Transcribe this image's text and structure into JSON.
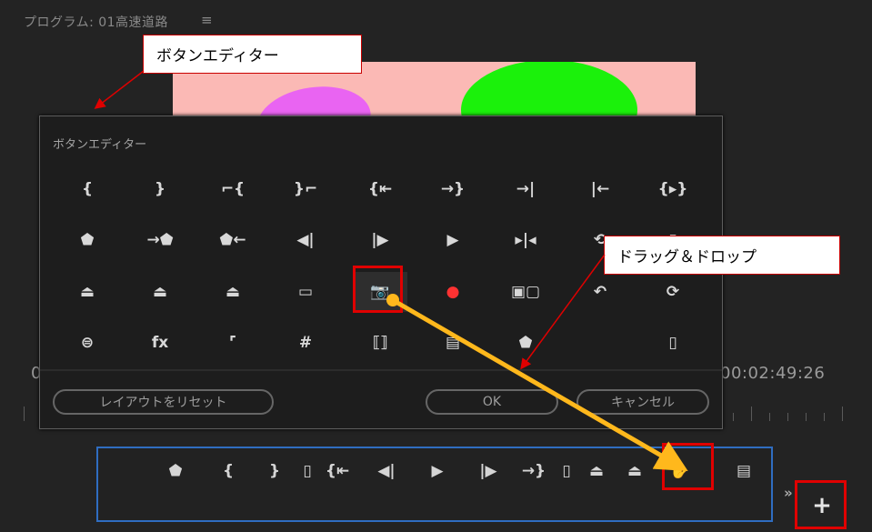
{
  "monitor": {
    "title": "プログラム: 01高速道路",
    "menu_icon": "hamburger-menu-icon",
    "timecode_left": "0",
    "timecode_right": "00:02:49:26"
  },
  "dialog": {
    "title": "ボタンエディター",
    "buttons": [
      {
        "name": "mark-in-icon",
        "glyph": "{"
      },
      {
        "name": "mark-out-icon",
        "glyph": "}"
      },
      {
        "name": "clear-in-icon",
        "glyph": "⌐{"
      },
      {
        "name": "clear-out-icon",
        "glyph": "}⌐"
      },
      {
        "name": "go-to-in-icon",
        "glyph": "{⇤"
      },
      {
        "name": "go-to-out-icon",
        "glyph": "→}"
      },
      {
        "name": "go-to-next-edit-icon",
        "glyph": "→|"
      },
      {
        "name": "go-to-previous-edit-icon",
        "glyph": "|←"
      },
      {
        "name": "play-in-to-out-icon",
        "glyph": "{▸}"
      },
      {
        "name": "add-marker-icon",
        "glyph": "⬟"
      },
      {
        "name": "go-to-next-marker-icon",
        "glyph": "→⬟"
      },
      {
        "name": "go-to-previous-marker-icon",
        "glyph": "⬟←"
      },
      {
        "name": "step-back-icon",
        "glyph": "◀|"
      },
      {
        "name": "step-forward-icon",
        "glyph": "|▶"
      },
      {
        "name": "play-stop-icon",
        "glyph": "▶"
      },
      {
        "name": "play-around-icon",
        "glyph": "▸|◂"
      },
      {
        "name": "loop-icon",
        "glyph": "⟲"
      },
      {
        "name": "safe-margins-icon",
        "glyph": "▯"
      },
      {
        "name": "lift-icon",
        "glyph": "⏏"
      },
      {
        "name": "extract-icon",
        "glyph": "⏏"
      },
      {
        "name": "insert-icon",
        "glyph": "⏏"
      },
      {
        "name": "overwrite-frame-icon",
        "glyph": "▭"
      },
      {
        "name": "export-frame-camera-icon",
        "glyph": "📷"
      },
      {
        "name": "record-icon",
        "glyph": "●"
      },
      {
        "name": "multi-camera-view-icon",
        "glyph": "▣▢"
      },
      {
        "name": "restore-cropping-icon",
        "glyph": "↶"
      },
      {
        "name": "vr-video-icon",
        "glyph": "⟳"
      },
      {
        "name": "vr-view-toggle-icon",
        "glyph": "⊜"
      },
      {
        "name": "fx-icon",
        "glyph": "fx"
      },
      {
        "name": "ruler-icon",
        "glyph": "⌜"
      },
      {
        "name": "grid-icon",
        "glyph": "#"
      },
      {
        "name": "comparison-view-icon",
        "glyph": "⟦⟧"
      },
      {
        "name": "proxy-toggle-icon",
        "glyph": "▤"
      },
      {
        "name": "marker-lock-icon",
        "glyph": "⬟"
      },
      {
        "name": "empty-slot",
        "glyph": ""
      },
      {
        "name": "spacer-icon",
        "glyph": "▯"
      }
    ],
    "reset_label": "レイアウトをリセット",
    "ok_label": "OK",
    "cancel_label": "キャンセル"
  },
  "button_bar": {
    "items": [
      {
        "name": "add-marker-icon",
        "glyph": "⬟"
      },
      {
        "name": "mark-in-icon",
        "glyph": "{"
      },
      {
        "name": "mark-out-icon",
        "glyph": "}"
      },
      {
        "name": "spacer-icon",
        "glyph": "▯"
      },
      {
        "name": "go-to-in-icon",
        "glyph": "{⇤"
      },
      {
        "name": "step-back-icon",
        "glyph": "◀|"
      },
      {
        "name": "play-stop-icon",
        "glyph": "▶"
      },
      {
        "name": "step-forward-icon",
        "glyph": "|▶"
      },
      {
        "name": "go-to-out-icon",
        "glyph": "→}"
      },
      {
        "name": "spacer-icon",
        "glyph": "▯"
      },
      {
        "name": "lift-icon",
        "glyph": "⏏"
      },
      {
        "name": "extract-icon",
        "glyph": "⏏"
      },
      {
        "name": "drag-hand-camera-icon",
        "glyph": "✋"
      },
      {
        "name": "proxy-toggle-icon",
        "glyph": "▤"
      }
    ],
    "more_label": "»",
    "add_label": "+"
  },
  "annotations": {
    "callout_button_editor": "ボタンエディター",
    "callout_drag_drop": "ドラッグ＆ドロップ",
    "arrow_color": "#ffb81c",
    "highlight_color": "#e00000"
  }
}
